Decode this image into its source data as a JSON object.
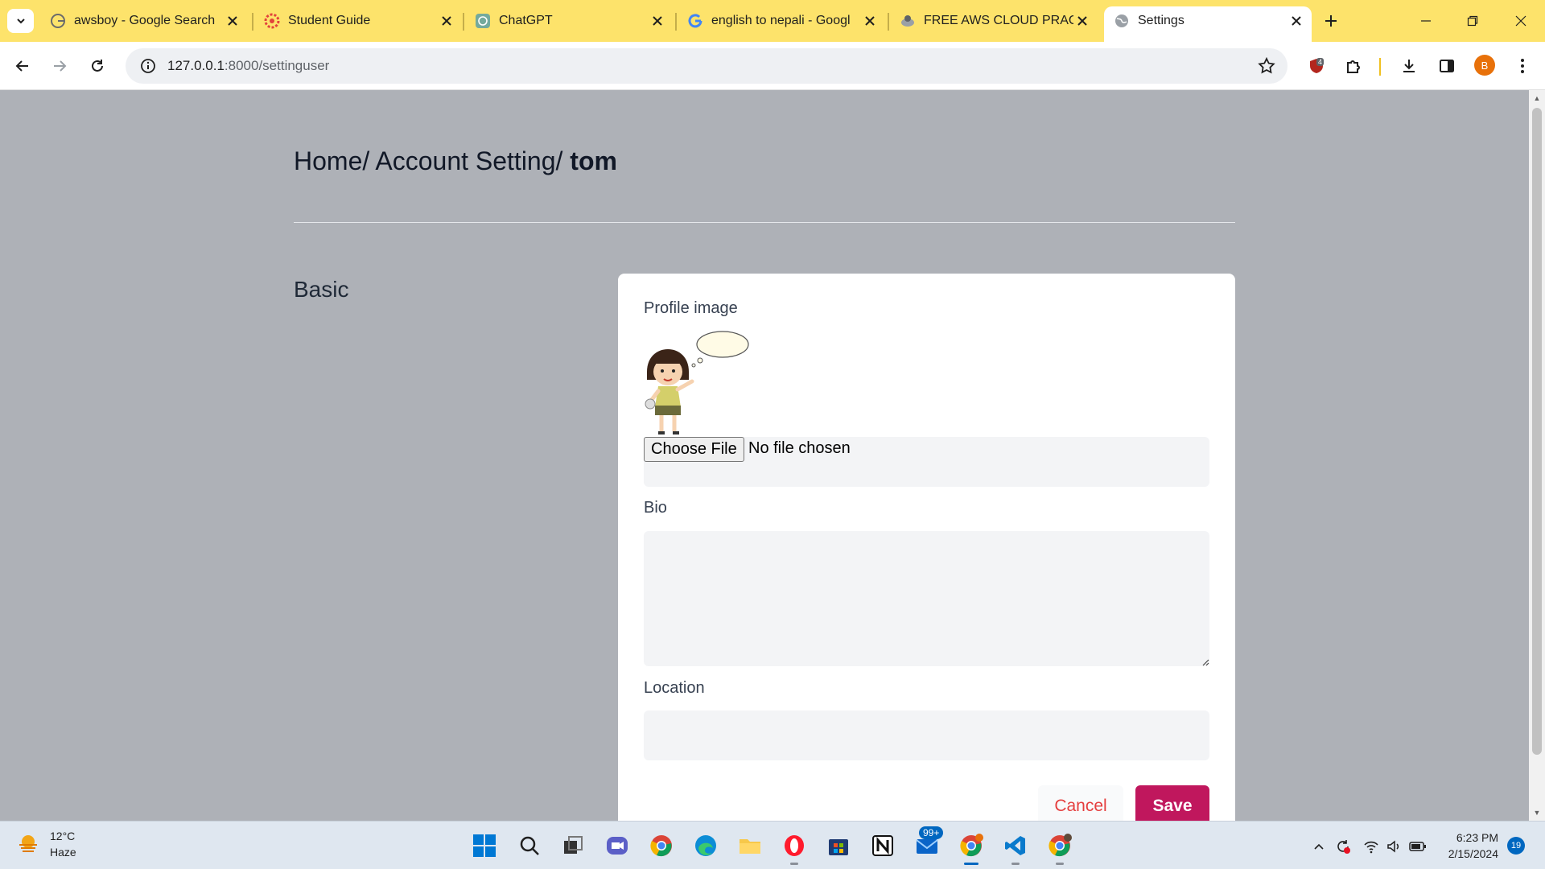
{
  "browser": {
    "tabs": [
      {
        "title": "awsboy - Google Search",
        "icon": "google-icon"
      },
      {
        "title": "Student Guide",
        "icon": "student-guide-icon"
      },
      {
        "title": "ChatGPT",
        "icon": "chatgpt-icon"
      },
      {
        "title": "english to nepali - Googl",
        "icon": "google-icon"
      },
      {
        "title": "FREE AWS CLOUD PRACT",
        "icon": "aws-course-icon"
      },
      {
        "title": "Settings",
        "icon": "globe-icon",
        "active": true
      }
    ],
    "url_host": "127.0.0.1",
    "url_path": ":8000/settinguser",
    "extension_badge": "4",
    "profile_initial": "B",
    "colors": {
      "tabstrip": "#fde36b",
      "accent": "#c0175d",
      "cancel": "#e53e3e"
    }
  },
  "page": {
    "breadcrumb": {
      "home": "Home/",
      "section": "Account Setting/",
      "current": "tom"
    },
    "section_title": "Basic",
    "form": {
      "profile_image_label": "Profile image",
      "file_button": "Choose File",
      "file_status": "No file chosen",
      "bio_label": "Bio",
      "bio_value": "",
      "location_label": "Location",
      "location_value": "",
      "cancel": "Cancel",
      "save": "Save"
    }
  },
  "taskbar": {
    "weather": {
      "temp": "12°C",
      "condition": "Haze"
    },
    "mail_badge": "99+",
    "time": "6:23 PM",
    "date": "2/15/2024",
    "notifications": "19"
  }
}
